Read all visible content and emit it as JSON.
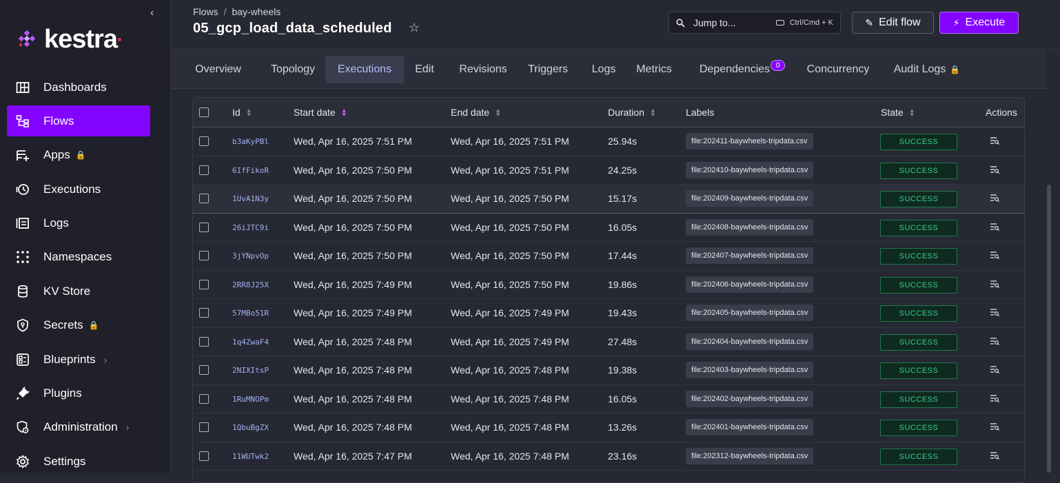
{
  "brand": {
    "name": "kestra",
    "accent": "#8405ff",
    "brand_dot": "#e3245f"
  },
  "sidebar": {
    "items": [
      {
        "label": "Dashboards",
        "icon": "dashboard-icon",
        "active": false
      },
      {
        "label": "Flows",
        "icon": "flow-icon",
        "active": true
      },
      {
        "label": "Apps",
        "icon": "apps-icon",
        "active": false,
        "locked": true
      },
      {
        "label": "Executions",
        "icon": "history-icon",
        "active": false
      },
      {
        "label": "Logs",
        "icon": "logs-icon",
        "active": false
      },
      {
        "label": "Namespaces",
        "icon": "grid-dots-icon",
        "active": false
      },
      {
        "label": "KV Store",
        "icon": "database-icon",
        "active": false
      },
      {
        "label": "Secrets",
        "icon": "key-shield-icon",
        "active": false,
        "locked": true
      },
      {
        "label": "Blueprints",
        "icon": "blueprint-icon",
        "active": false,
        "submenu": true
      },
      {
        "label": "Plugins",
        "icon": "plug-icon",
        "active": false
      },
      {
        "label": "Administration",
        "icon": "shield-gear-icon",
        "active": false,
        "submenu": true
      },
      {
        "label": "Settings",
        "icon": "gear-icon",
        "active": false
      }
    ]
  },
  "header": {
    "breadcrumb": [
      "Flows",
      "bay-wheels"
    ],
    "title": "05_gcp_load_data_scheduled",
    "search_label": "Jump to...",
    "search_shortcut": "Ctrl/Cmd + K",
    "edit_label": "Edit flow",
    "execute_label": "Execute"
  },
  "tabs": [
    {
      "label": "Overview",
      "active": false
    },
    {
      "label": "Topology",
      "active": false
    },
    {
      "label": "Executions",
      "active": true
    },
    {
      "label": "Edit",
      "active": false
    },
    {
      "label": "Revisions",
      "active": false
    },
    {
      "label": "Triggers",
      "active": false
    },
    {
      "label": "Logs",
      "active": false
    },
    {
      "label": "Metrics",
      "active": false
    },
    {
      "label": "Dependencies",
      "active": false,
      "badge": "0"
    },
    {
      "label": "Concurrency",
      "active": false
    },
    {
      "label": "Audit Logs",
      "active": false,
      "locked": true
    }
  ],
  "table": {
    "columns": [
      "Id",
      "Start date",
      "End date",
      "Duration",
      "Labels",
      "State",
      "Actions"
    ],
    "rows": [
      {
        "id": "b3aKyPBl",
        "start": "Wed, Apr 16, 2025 7:51 PM",
        "end": "Wed, Apr 16, 2025 7:51 PM",
        "duration": "25.94s",
        "label": "file:202411-baywheels-tripdata.csv",
        "state": "SUCCESS"
      },
      {
        "id": "6IfFikoR",
        "start": "Wed, Apr 16, 2025 7:50 PM",
        "end": "Wed, Apr 16, 2025 7:51 PM",
        "duration": "24.25s",
        "label": "file:202410-baywheels-tripdata.csv",
        "state": "SUCCESS"
      },
      {
        "id": "1UvA1N3y",
        "start": "Wed, Apr 16, 2025 7:50 PM",
        "end": "Wed, Apr 16, 2025 7:50 PM",
        "duration": "15.17s",
        "label": "file:202409-baywheels-tripdata.csv",
        "state": "SUCCESS"
      },
      {
        "id": "26iJTC9i",
        "start": "Wed, Apr 16, 2025 7:50 PM",
        "end": "Wed, Apr 16, 2025 7:50 PM",
        "duration": "16.05s",
        "label": "file:202408-baywheels-tripdata.csv",
        "state": "SUCCESS"
      },
      {
        "id": "3jYNpvOp",
        "start": "Wed, Apr 16, 2025 7:50 PM",
        "end": "Wed, Apr 16, 2025 7:50 PM",
        "duration": "17.44s",
        "label": "file:202407-baywheels-tripdata.csv",
        "state": "SUCCESS"
      },
      {
        "id": "2RR8J25X",
        "start": "Wed, Apr 16, 2025 7:49 PM",
        "end": "Wed, Apr 16, 2025 7:50 PM",
        "duration": "19.86s",
        "label": "file:202406-baywheels-tripdata.csv",
        "state": "SUCCESS"
      },
      {
        "id": "57MBo51R",
        "start": "Wed, Apr 16, 2025 7:49 PM",
        "end": "Wed, Apr 16, 2025 7:49 PM",
        "duration": "19.43s",
        "label": "file:202405-baywheels-tripdata.csv",
        "state": "SUCCESS"
      },
      {
        "id": "1q4ZwaF4",
        "start": "Wed, Apr 16, 2025 7:48 PM",
        "end": "Wed, Apr 16, 2025 7:49 PM",
        "duration": "27.48s",
        "label": "file:202404-baywheels-tripdata.csv",
        "state": "SUCCESS"
      },
      {
        "id": "2NIXItsP",
        "start": "Wed, Apr 16, 2025 7:48 PM",
        "end": "Wed, Apr 16, 2025 7:48 PM",
        "duration": "19.38s",
        "label": "file:202403-baywheels-tripdata.csv",
        "state": "SUCCESS"
      },
      {
        "id": "1RuMNOPm",
        "start": "Wed, Apr 16, 2025 7:48 PM",
        "end": "Wed, Apr 16, 2025 7:48 PM",
        "duration": "16.05s",
        "label": "file:202402-baywheels-tripdata.csv",
        "state": "SUCCESS"
      },
      {
        "id": "1QbuBgZX",
        "start": "Wed, Apr 16, 2025 7:48 PM",
        "end": "Wed, Apr 16, 2025 7:48 PM",
        "duration": "13.26s",
        "label": "file:202401-baywheels-tripdata.csv",
        "state": "SUCCESS"
      },
      {
        "id": "11WUTwk2",
        "start": "Wed, Apr 16, 2025 7:47 PM",
        "end": "Wed, Apr 16, 2025 7:48 PM",
        "duration": "23.16s",
        "label": "file:202312-baywheels-tripdata.csv",
        "state": "SUCCESS"
      }
    ]
  }
}
